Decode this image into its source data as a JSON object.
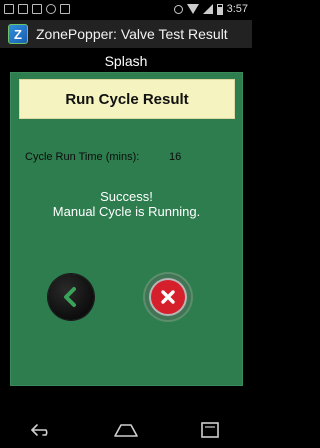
{
  "status_bar": {
    "time": "3:57",
    "icons": [
      "mail-icon",
      "gallery-icon",
      "app-icon",
      "sync-icon",
      "clipboard-icon",
      "alarm-icon",
      "wifi-icon",
      "signal-icon",
      "battery-icon"
    ]
  },
  "action_bar": {
    "app_icon_letter": "Z",
    "title": "ZonePopper: Valve Test Result"
  },
  "header": {
    "title": "Splash"
  },
  "panel": {
    "banner_title": "Run Cycle Result",
    "run_time_label": "Cycle Run Time (mins):",
    "run_time_value": "16",
    "status_line1": "Success!",
    "status_line2": "Manual Cycle is Running."
  },
  "buttons": {
    "back": "back-icon",
    "cancel": "close-icon"
  },
  "nav_bar": {
    "items": [
      "back-nav-icon",
      "home-nav-icon",
      "recents-nav-icon"
    ]
  },
  "colors": {
    "panel_bg": "#2e7d4f",
    "banner_bg": "#f5f3bf",
    "cancel_red": "#d51f2b",
    "back_chevron": "#3aa35a"
  }
}
